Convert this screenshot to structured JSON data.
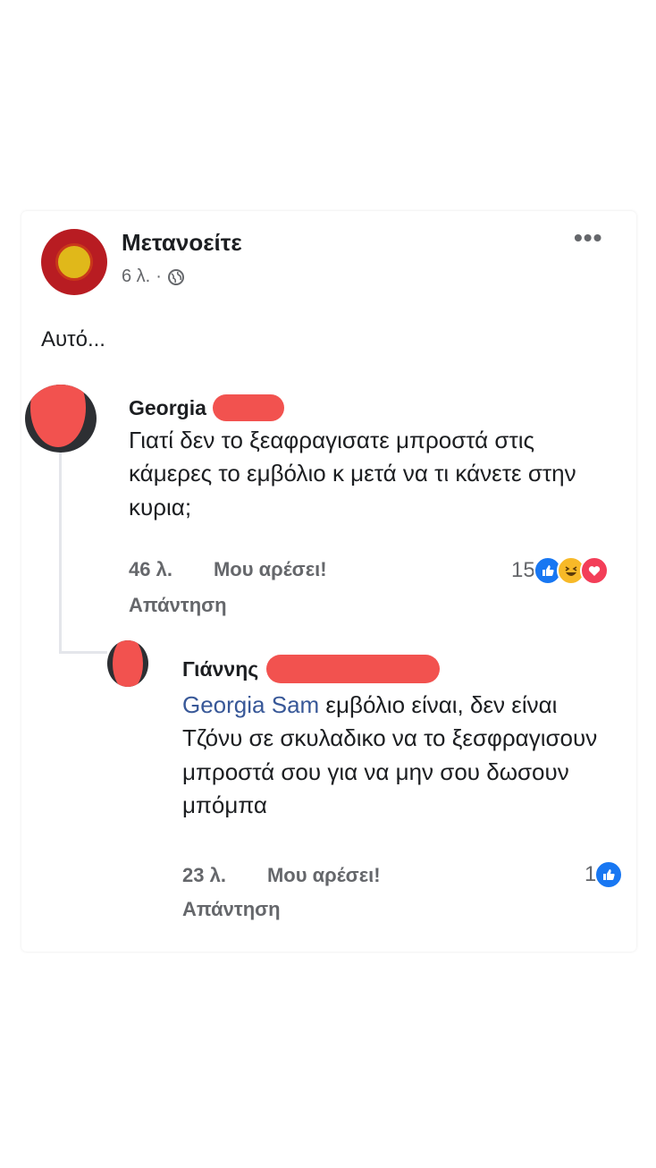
{
  "post": {
    "author": "Μετανοείτε",
    "time": "6 λ.",
    "separator": "·",
    "text": "Αυτό..."
  },
  "comments": [
    {
      "author": "Georgia",
      "text": "Γιατί δεν το ξεαφραγισατε μπροστά στις κάμερες το εμβόλιο κ μετά να τι κάνετε στην κυρια;",
      "time": "46 λ.",
      "like_label": "Μου αρέσει!",
      "reply_label": "Απάντηση",
      "reaction_count": "15",
      "reactions": [
        "like-icon",
        "haha-icon",
        "love-icon"
      ]
    },
    {
      "author": "Γιάννης",
      "mention": "Georgia Sam",
      "text": " εμβόλιο είναι, δεν είναι Τζόνυ σε σκυλαδικο να το ξεσφραγισουν μπροστά σου για να μην σου δωσουν μπόμπα",
      "time": "23 λ.",
      "like_label": "Μου αρέσει!",
      "reply_label": "Απάντηση",
      "reaction_count": "1",
      "reactions": [
        "like-icon"
      ]
    }
  ],
  "colors": {
    "like": "#1877f2",
    "haha": "#f7b928",
    "love": "#f33e58",
    "mention": "#385898",
    "redaction": "#f2524f"
  }
}
